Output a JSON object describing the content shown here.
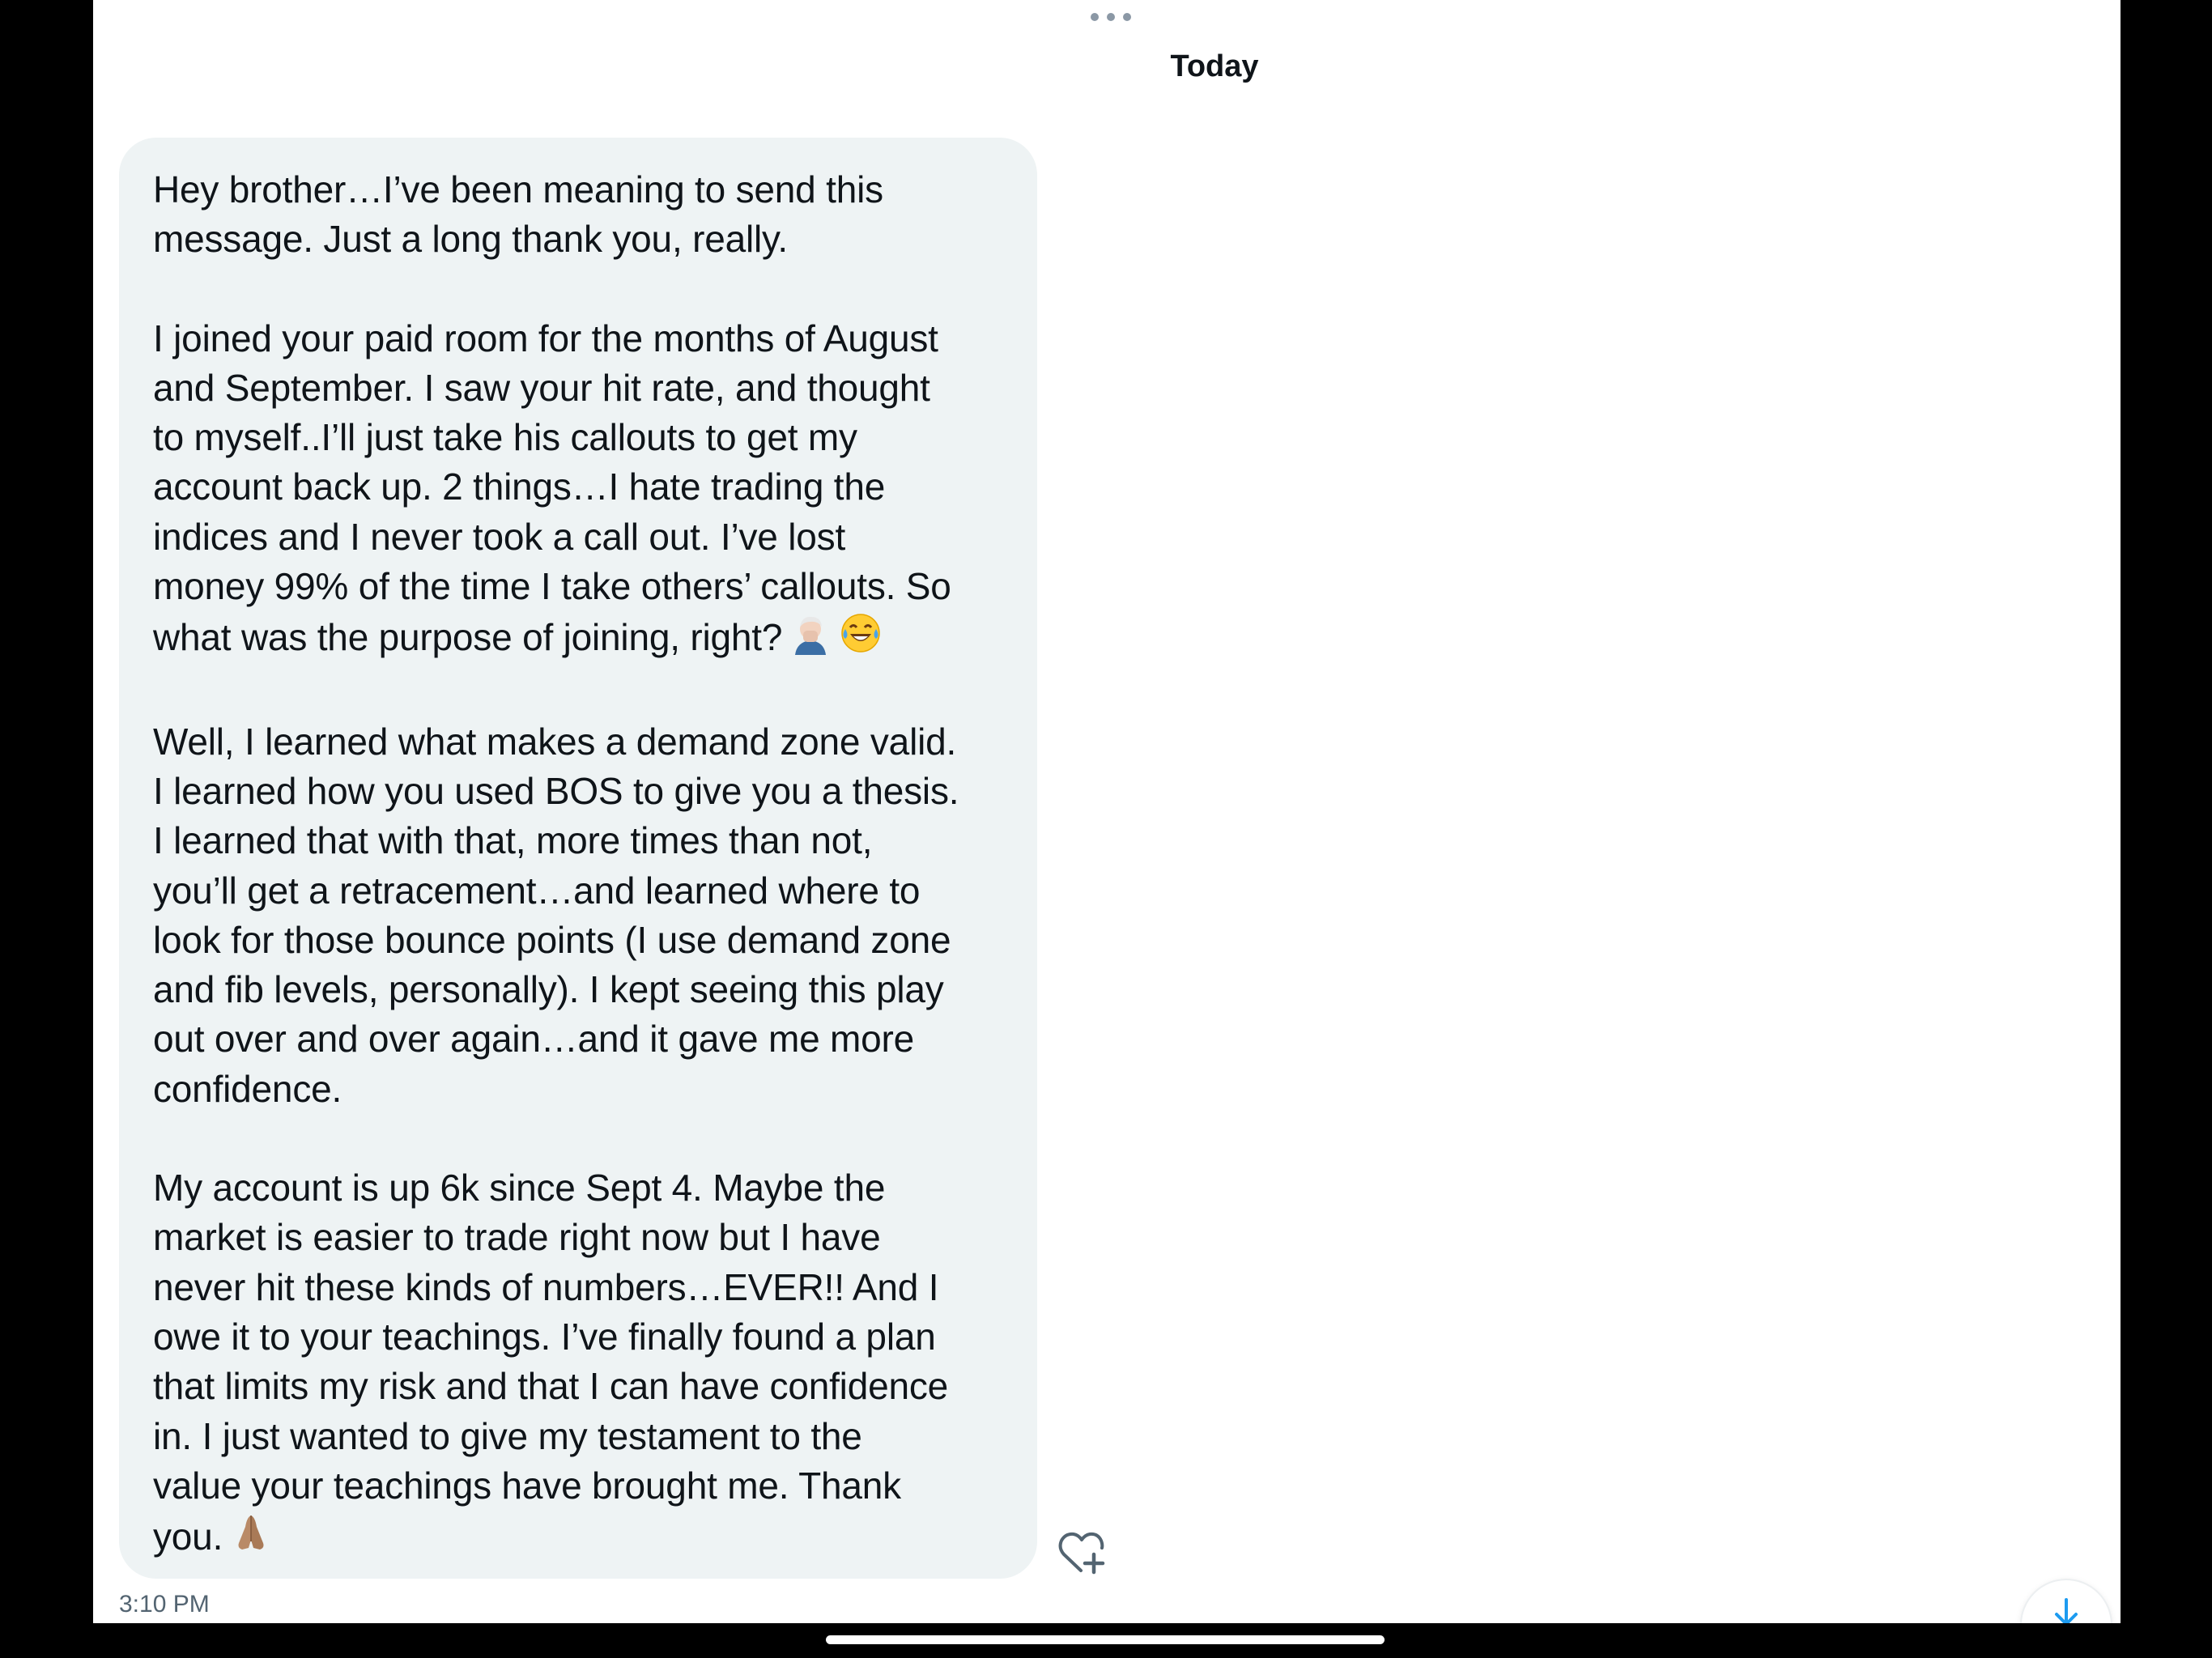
{
  "header": {
    "date_divider": "Today",
    "more_icon": "more-horizontal-icon"
  },
  "message": {
    "paragraphs": [
      "Hey brother…I’ve been meaning to send this\nmessage. Just a long thank you, really.",
      "I joined your paid room for the months of August\nand September. I saw your hit rate, and thought\nto myself..I’ll just take his callouts to get my\naccount back up. 2 things…I hate trading the\nindices and I never took a call out. I’ve lost\nmoney 99% of the time I take others’ callouts. So\nwhat was the purpose of joining, right?",
      "Well, I learned what makes a demand zone valid.\nI learned how you used BOS to give you a thesis.\nI learned that with that, more times than not,\nyou’ll get a retracement…and learned where to\nlook for those bounce points (I use demand zone\nand fib levels, personally). I kept seeing this play\nout over and over again…and it gave me more\nconfidence.",
      "My account is up 6k since Sept 4. Maybe the\nmarket is easier to trade right now but I have\nnever hit these kinds of numbers…EVER!! And I\nowe it to your teachings. I’ve finally found a plan\nthat limits my risk and that I can have confidence\nin. I just wanted to give my testament to the\nvalue your teachings have brought me. Thank\nyou."
    ],
    "emojis": {
      "facepalm": "facepalm-emoji",
      "laughing": "tears-of-joy-emoji",
      "praying": "folded-hands-emoji"
    },
    "timestamp": "3:10 PM",
    "react_icon": "heart-plus-icon"
  },
  "scroll_to_bottom": {
    "icon": "arrow-down-icon"
  },
  "colors": {
    "bubble_bg": "#eef3f4",
    "text": "#0f1419",
    "muted": "#536471",
    "accent": "#1d9bf0"
  }
}
